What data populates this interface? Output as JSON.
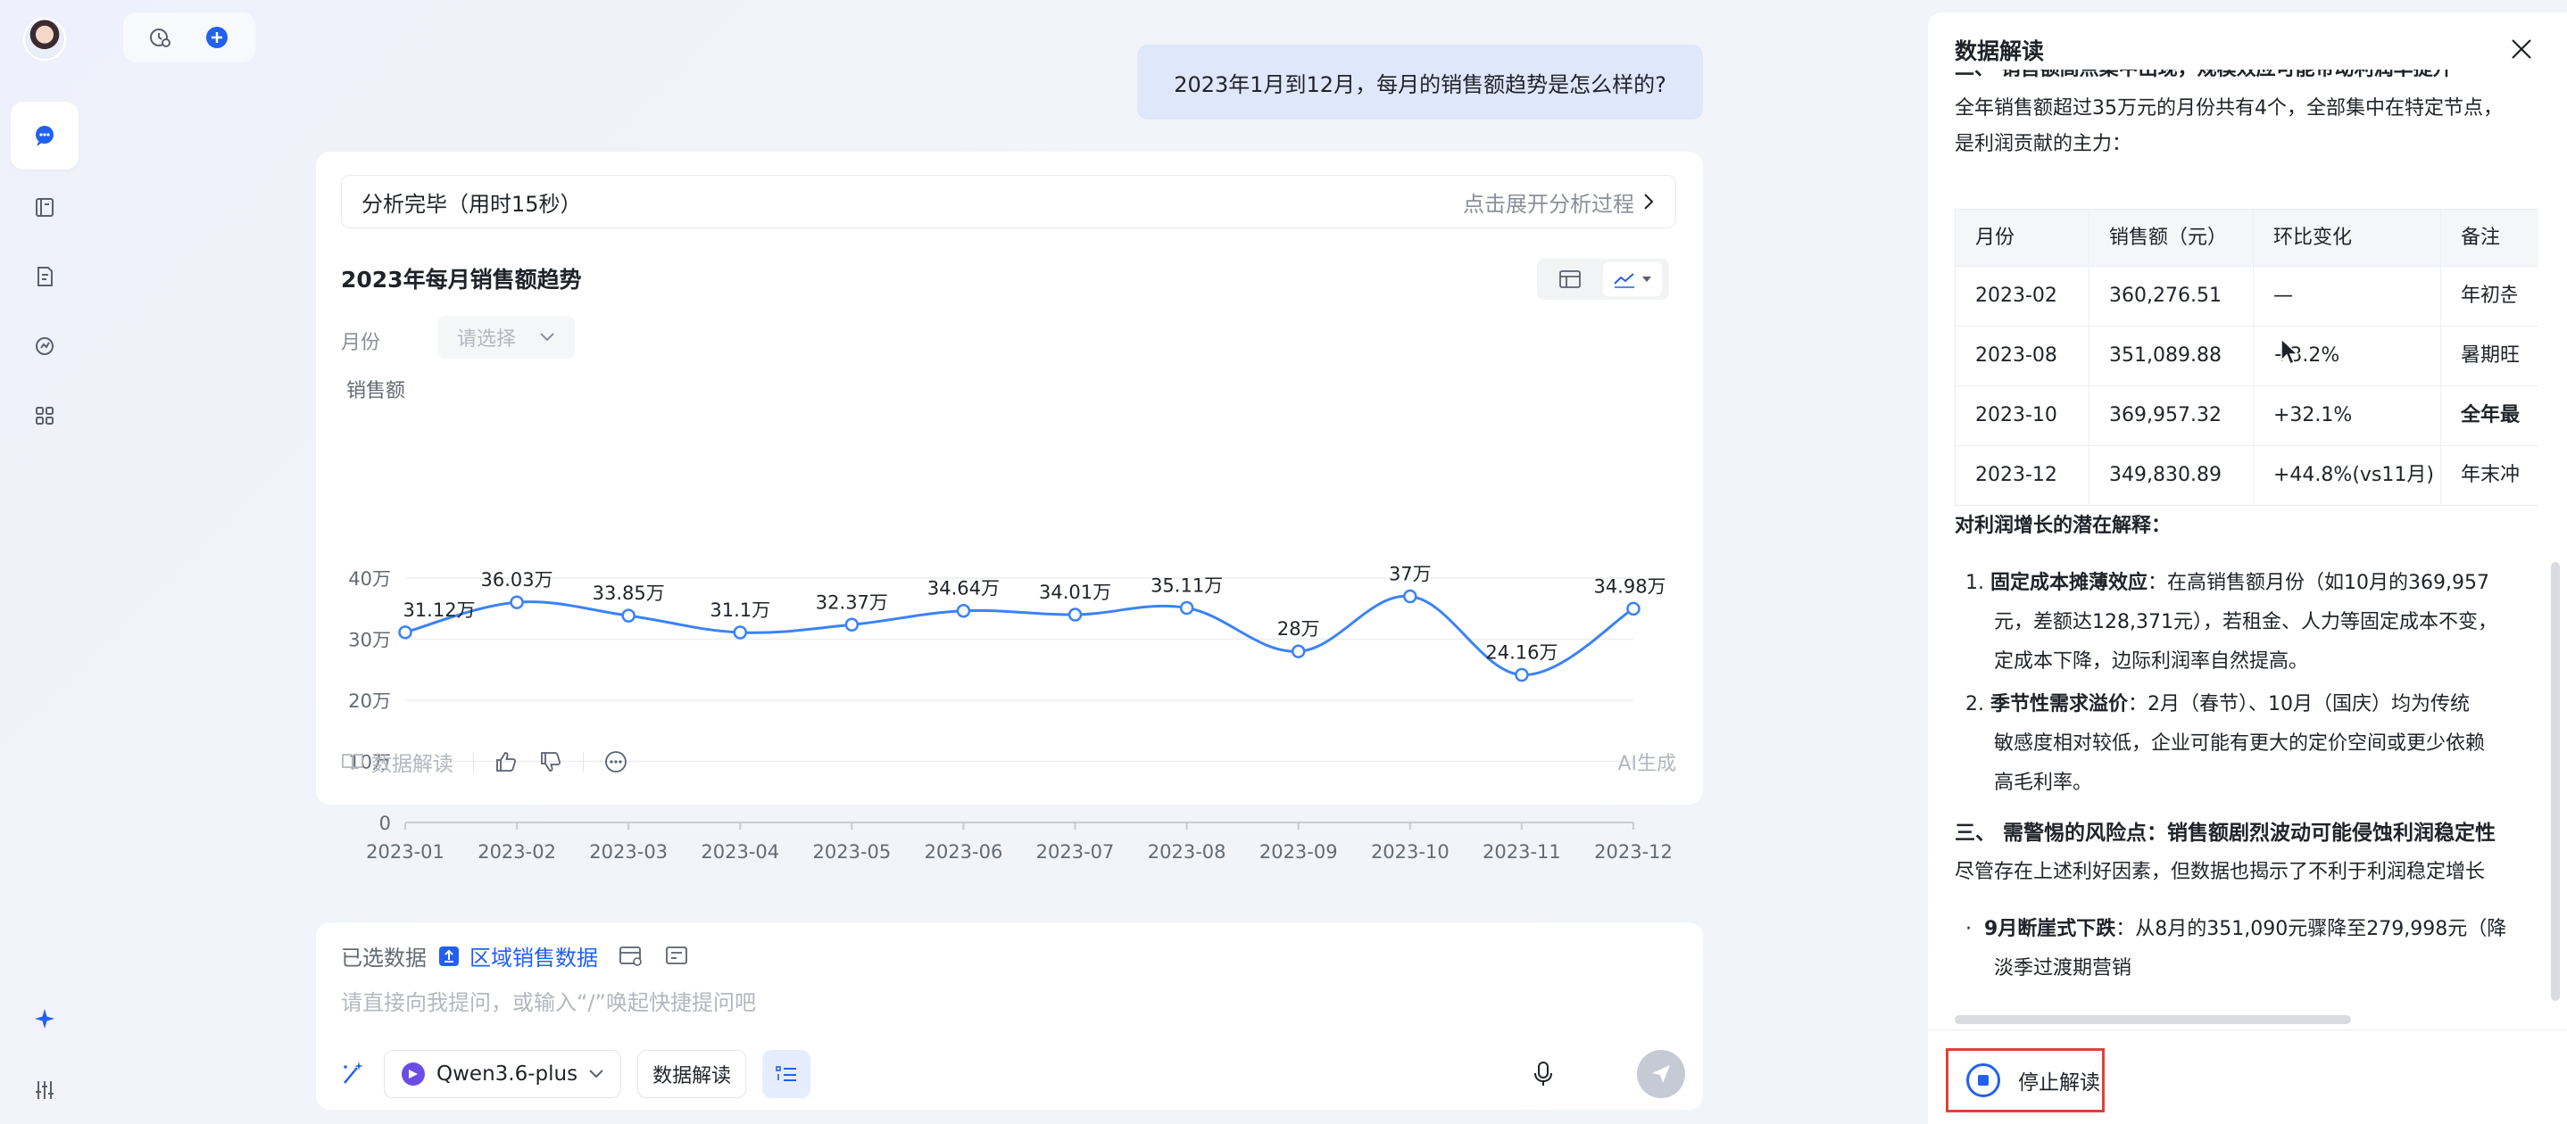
{
  "user_question": "2023年1月到12月，每月的销售额趋势是怎么样的?",
  "analysis": {
    "status": "分析完毕（用时15秒）",
    "expand_label": "点击展开分析过程"
  },
  "chart_panel": {
    "filter_label": "月份",
    "filter_placeholder": "请选择",
    "footer": {
      "interpret": "数据解读",
      "ai_badge": "AI生成"
    }
  },
  "chart_data": {
    "type": "line",
    "title": "2023年每月销售额趋势",
    "ylabel": "销售额",
    "ylim": [
      0,
      40
    ],
    "yticks": [
      "0",
      "10万",
      "20万",
      "30万",
      "40万"
    ],
    "categories": [
      "2023-01",
      "2023-02",
      "2023-03",
      "2023-04",
      "2023-05",
      "2023-06",
      "2023-07",
      "2023-08",
      "2023-09",
      "2023-10",
      "2023-11",
      "2023-12"
    ],
    "values": [
      31.12,
      36.03,
      33.85,
      31.1,
      32.37,
      34.64,
      34.01,
      35.11,
      28,
      37,
      24.16,
      34.98
    ],
    "data_labels": [
      "31.12万",
      "36.03万",
      "33.85万",
      "31.1万",
      "32.37万",
      "34.64万",
      "34.01万",
      "35.11万",
      "28万",
      "37万",
      "24.16万",
      "34.98万"
    ],
    "series_color": "#3b82f6",
    "grid": true
  },
  "input": {
    "selected_label": "已选数据",
    "dataset": "区域销售数据",
    "placeholder": "请直接向我提问，或输入“/”唤起快捷提问吧",
    "model": "Qwen3.6-plus",
    "chip_interpret": "数据解读"
  },
  "panel": {
    "title": "数据解读",
    "cut_heading": "二、 销售额高点集中出现，规模效应可能带动利润率提升",
    "p1": "全年销售额超过35万元的月份共有4个，全部集中在特定节点，",
    "p2": "是利润贡献的主力：",
    "table_headers": [
      "月份",
      "销售额（元）",
      "环比变化",
      "备注"
    ],
    "table_rows": [
      [
        "2023-02",
        "360,276.51",
        "—",
        "年初춘"
      ],
      [
        "2023-08",
        "351,089.88",
        "+3.2%",
        "暑期旺"
      ],
      [
        "2023-10",
        "369,957.32",
        "+32.1%",
        "全年最"
      ],
      [
        "2023-12",
        "349,830.89",
        "+44.8%(vs11月)",
        "年末冲"
      ]
    ],
    "sub_heading": "对利润增长的潜在解释：",
    "item1_title": "固定成本摊薄效应",
    "item1_l1": "：在高销售额月份（如10月的369,957",
    "item1_l2": "元，差额达128,371元），若租金、人力等固定成本不变，",
    "item1_l3": "定成本下降，边际利润率自然提高。",
    "item2_title": "季节性需求溢价",
    "item2_l1": "：2月（春节）、10月（国庆）均为传统",
    "item2_l2": "敏感度相对较低，企业可能有更大的定价空间或更少依赖",
    "item2_l3": "高毛利率。",
    "heading3": "三、 需警惕的风险点：销售额剧烈波动可能侵蚀利润稳定性",
    "p3": "尽管存在上述利好因素，但数据也揭示了不利于利润稳定增长",
    "bullet_title": "9月断崖式下跌",
    "bullet_l1": "：从8月的351,090元骤降至279,998元（降",
    "bullet_l2": "淡季过渡期营销",
    "stop_label": "停止解读"
  }
}
